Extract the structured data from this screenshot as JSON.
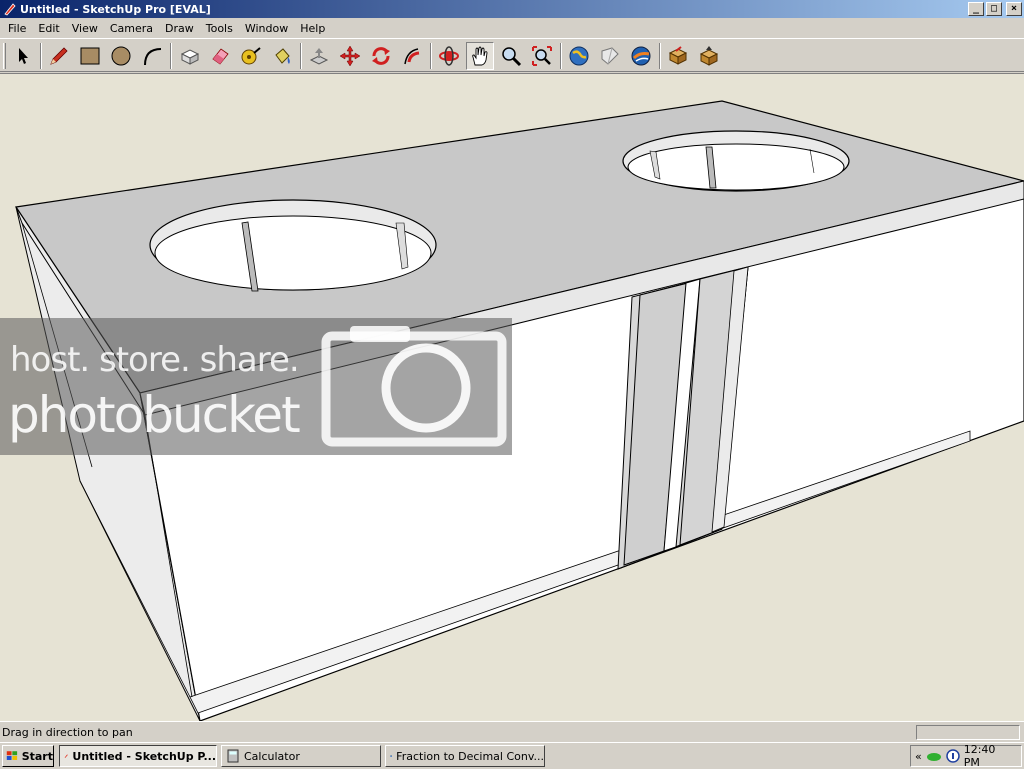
{
  "window": {
    "title": "Untitled - SketchUp Pro [EVAL]",
    "min_glyph": "_",
    "max_glyph": "□",
    "close_glyph": "×"
  },
  "menu": [
    "File",
    "Edit",
    "View",
    "Camera",
    "Draw",
    "Tools",
    "Window",
    "Help"
  ],
  "toolbar": {
    "tools": [
      "select",
      "pencil",
      "rectangle",
      "circle",
      "arc",
      "make-component",
      "eraser",
      "tape-measure",
      "paint-bucket",
      "push-pull",
      "move",
      "rotate",
      "follow-me",
      "orbit",
      "pan",
      "zoom",
      "zoom-extents",
      "get-models",
      "share-model",
      "google-earth",
      "components",
      "warehouse"
    ],
    "active_tool": "pan"
  },
  "watermark": {
    "line1": "host. store. share.",
    "line2": "photobucket"
  },
  "status": {
    "message": "Drag in direction to pan"
  },
  "taskbar": {
    "start_label": "Start",
    "tasks": [
      {
        "label": "Untitled - SketchUp P...",
        "active": true
      },
      {
        "label": "Calculator",
        "active": false
      },
      {
        "label": "Fraction to Decimal Conv...",
        "active": false
      }
    ],
    "tray_chevron": "«",
    "clock": "12:40 PM"
  },
  "colors": {
    "titlebar_start": "#0a246a",
    "titlebar_end": "#a6caf0",
    "viewport_bg": "#e6e3d4",
    "box_top": "#c8c8c8",
    "box_side": "#ffffff"
  }
}
